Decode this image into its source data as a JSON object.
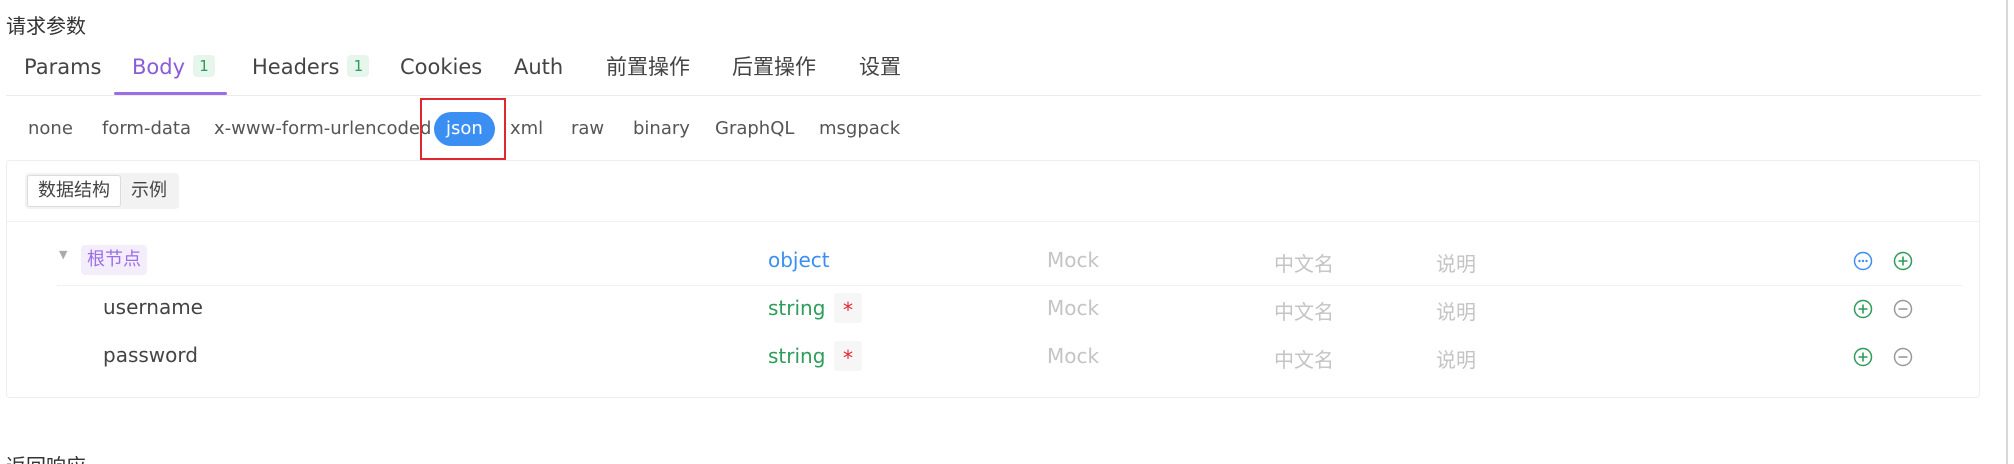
{
  "section": {
    "title": "请求参数"
  },
  "tabs": [
    {
      "label": "Params",
      "badge": null
    },
    {
      "label": "Body",
      "badge": "1",
      "active": true
    },
    {
      "label": "Headers",
      "badge": "1"
    },
    {
      "label": "Cookies",
      "badge": null
    },
    {
      "label": "Auth",
      "badge": null
    },
    {
      "label": "前置操作",
      "badge": null
    },
    {
      "label": "后置操作",
      "badge": null
    },
    {
      "label": "设置",
      "badge": null
    }
  ],
  "body_types": [
    "none",
    "form-data",
    "x-www-form-urlencoded",
    "json",
    "xml",
    "raw",
    "binary",
    "GraphQL",
    "msgpack"
  ],
  "body_type_selected": "json",
  "view_toggle": {
    "structure": "数据结构",
    "example": "示例",
    "selected": "数据结构"
  },
  "schema": {
    "root": {
      "label": "根节点",
      "type": "object",
      "mock_placeholder": "Mock",
      "cn_placeholder": "中文名",
      "desc_placeholder": "说明"
    },
    "fields": [
      {
        "name": "username",
        "type": "string",
        "required_mark": "*",
        "mock_placeholder": "Mock",
        "cn_placeholder": "中文名",
        "desc_placeholder": "说明"
      },
      {
        "name": "password",
        "type": "string",
        "required_mark": "*",
        "mock_placeholder": "Mock",
        "cn_placeholder": "中文名",
        "desc_placeholder": "说明"
      }
    ]
  },
  "next_section": {
    "title": "返回响应"
  },
  "colors": {
    "accent_purple": "#8a5cd8",
    "accent_blue": "#3b8ff2",
    "green": "#2e9c5a",
    "red": "#e0262e"
  },
  "icons": {
    "more": "more-circle-icon",
    "add": "plus-circle-icon",
    "remove": "minus-circle-icon",
    "collapse": "caret-down-icon"
  }
}
